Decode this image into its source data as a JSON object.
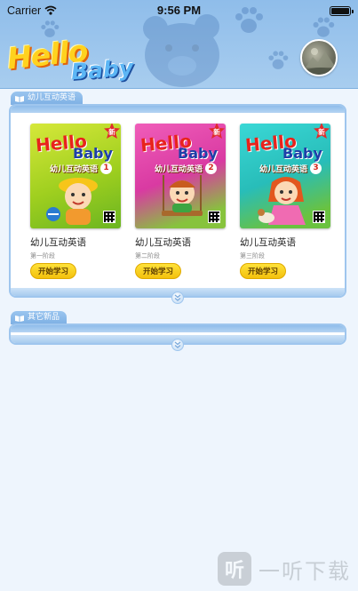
{
  "status_bar": {
    "carrier": "Carrier",
    "time": "9:56 PM"
  },
  "header": {
    "logo_line1": "Hello",
    "logo_line2": "Baby"
  },
  "sections": [
    {
      "label": "幼儿互动英语",
      "books": [
        {
          "title": "幼儿互动英语",
          "level": "第一阶段",
          "button": "开始学习",
          "cover_hello": "Hello",
          "cover_baby": "Baby",
          "cover_sub": "幼儿互动英语",
          "cover_num": "1",
          "badge": "新",
          "cover_color": "#c6dd22"
        },
        {
          "title": "幼儿互动英语",
          "level": "第二阶段",
          "button": "开始学习",
          "cover_hello": "Hello",
          "cover_baby": "Baby",
          "cover_sub": "幼儿互动英语",
          "cover_num": "2",
          "badge": "新",
          "cover_color": "#e43fa6"
        },
        {
          "title": "幼儿互动英语",
          "level": "第三阶段",
          "button": "开始学习",
          "cover_hello": "Hello",
          "cover_baby": "Baby",
          "cover_sub": "幼儿互动英语",
          "cover_num": "3",
          "badge": "新",
          "cover_color": "#2fc9c8"
        }
      ]
    },
    {
      "label": "其它新品",
      "books": []
    }
  ],
  "watermark": {
    "logo": "听",
    "text": "一听下载"
  },
  "colors": {
    "header_blue": "#8fbdea",
    "panel_border": "#9fc6ee",
    "button_yellow": "#f3c10d",
    "page_bg": "#eef5fd"
  }
}
